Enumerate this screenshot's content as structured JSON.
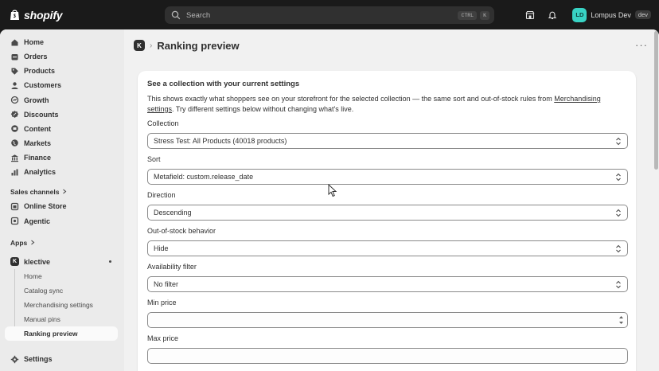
{
  "topbar": {
    "logo_text": "shopify",
    "search_placeholder": "Search",
    "shortcut_ctrl": "CTRL",
    "shortcut_k": "K",
    "user_initials": "LD",
    "user_name": "Lompus Dev",
    "env_badge": "dev"
  },
  "sidebar": {
    "items": [
      {
        "label": "Home",
        "icon": "home-icon"
      },
      {
        "label": "Orders",
        "icon": "orders-icon"
      },
      {
        "label": "Products",
        "icon": "tag-icon"
      },
      {
        "label": "Customers",
        "icon": "person-icon"
      },
      {
        "label": "Growth",
        "icon": "growth-icon"
      },
      {
        "label": "Discounts",
        "icon": "discount-icon"
      },
      {
        "label": "Content",
        "icon": "content-icon"
      },
      {
        "label": "Markets",
        "icon": "globe-icon"
      },
      {
        "label": "Finance",
        "icon": "bank-icon"
      },
      {
        "label": "Analytics",
        "icon": "chart-icon"
      }
    ],
    "sales_channels_label": "Sales channels",
    "channels": [
      {
        "label": "Online Store",
        "icon": "store-icon"
      },
      {
        "label": "Agentic",
        "icon": "agentic-icon"
      }
    ],
    "apps_label": "Apps",
    "app": {
      "label": "klective",
      "icon_letter": "K"
    },
    "app_sub_items": [
      "Home",
      "Catalog sync",
      "Merchandising settings",
      "Manual pins",
      "Ranking preview"
    ],
    "settings_label": "Settings"
  },
  "page": {
    "breadcrumb_letter": "K",
    "title": "Ranking preview",
    "more": "···"
  },
  "card": {
    "title": "See a collection with your current settings",
    "desc_before": "This shows exactly what shoppers see on your storefront for the selected collection — the same sort and out-of-stock rules from ",
    "desc_link": "Merchandising settings",
    "desc_after": ". Try different settings below without changing what's live.",
    "fields": {
      "collection": {
        "label": "Collection",
        "value": "Stress Test: All Products (40018 products)"
      },
      "sort": {
        "label": "Sort",
        "value": "Metafield: custom.release_date"
      },
      "direction": {
        "label": "Direction",
        "value": "Descending"
      },
      "oos": {
        "label": "Out-of-stock behavior",
        "value": "Hide"
      },
      "availability": {
        "label": "Availability filter",
        "value": "No filter"
      },
      "min_price": {
        "label": "Min price",
        "value": ""
      },
      "max_price": {
        "label": "Max price",
        "value": ""
      }
    }
  }
}
